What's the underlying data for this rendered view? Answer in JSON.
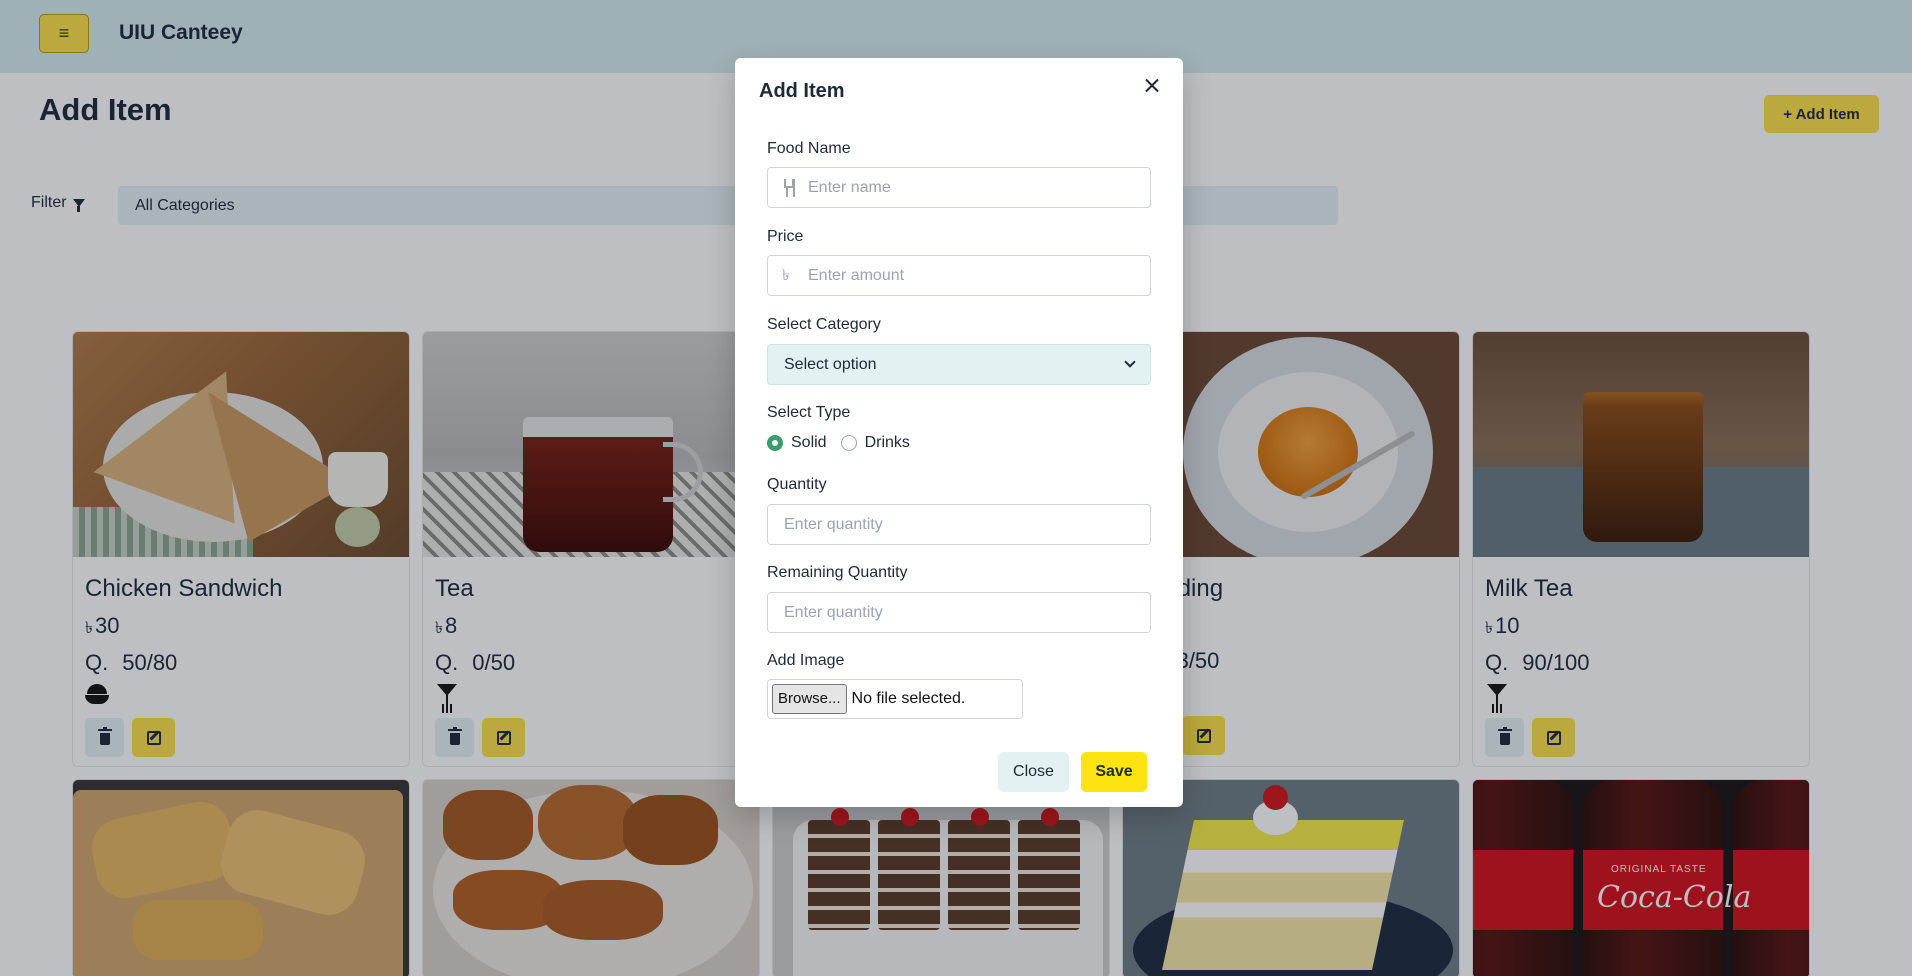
{
  "app": {
    "brand": "UIU Canteey",
    "menu_icon": "hamburger-icon",
    "accent": "#fde047",
    "bg_tint": "#d6ecee"
  },
  "page": {
    "title": "Add Item",
    "add_button": "+ Add Item"
  },
  "filter": {
    "label": "Filter",
    "selected": "All Categories"
  },
  "cards": [
    {
      "name": "Chicken Sandwich",
      "currency": "৳",
      "price": "30",
      "qty_label": "Q.",
      "qty": "50/80",
      "type": "Solid"
    },
    {
      "name": "Tea",
      "currency": "৳",
      "price": "8",
      "qty_label": "Q.",
      "qty": "0/50",
      "type": "Drinks"
    },
    {
      "name": "ding",
      "currency": "",
      "price": "",
      "qty_label": "",
      "qty": "3/50",
      "type": ""
    },
    {
      "name": "Milk Tea",
      "currency": "৳",
      "price": "10",
      "qty_label": "Q.",
      "qty": "90/100",
      "type": "Drinks"
    }
  ],
  "modal": {
    "title": "Add Item",
    "food_name": {
      "label": "Food Name",
      "placeholder": "Enter name"
    },
    "price": {
      "label": "Price",
      "placeholder": "Enter amount",
      "currency": "৳"
    },
    "category": {
      "label": "Select Category",
      "value": "Select option"
    },
    "type": {
      "label": "Select Type",
      "options": [
        "Solid",
        "Drinks"
      ],
      "selected": "Solid"
    },
    "quantity": {
      "label": "Quantity",
      "placeholder": "Enter quantity"
    },
    "remaining": {
      "label": "Remaining Quantity",
      "placeholder": "Enter quantity"
    },
    "image": {
      "label": "Add Image",
      "browse": "Browse...",
      "status": "No file selected."
    },
    "close_button": "Close",
    "save_button": "Save"
  },
  "coke": {
    "tagline": "ORIGINAL TASTE",
    "logo": "Coca-Cola"
  }
}
